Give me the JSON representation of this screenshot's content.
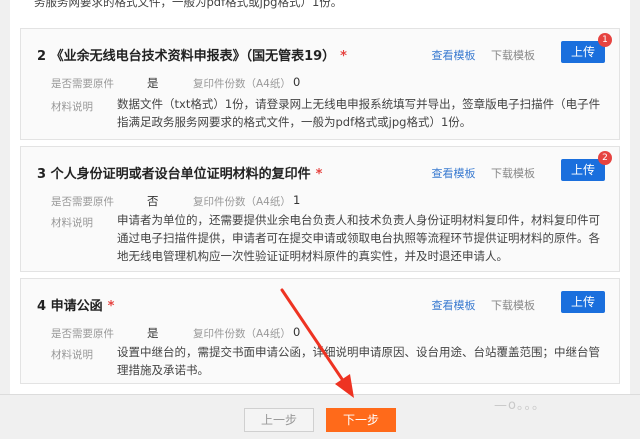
{
  "top_fragment": "务服务网要求的格式文件，一般为pdf格式或jpg格式）1份。",
  "labels": {
    "original_required": "是否需要原件",
    "copies": "复印件份数（A4纸）",
    "description": "材料说明",
    "view_template": "查看模板",
    "download_template": "下载模板",
    "upload": "上传"
  },
  "items": [
    {
      "title": "2 《业余无线电台技术资料申报表》（国无管表19）",
      "original_required": "是",
      "copies": "0",
      "description": "数据文件（txt格式）1份，请登录网上无线电申报系统填写并导出，签章版电子扫描件（电子件指满足政务服务网要求的格式文件，一般为pdf格式或jpg格式）1份。",
      "badge": "1"
    },
    {
      "title": "3 个人身份证明或者设台单位证明材料的复印件",
      "original_required": "否",
      "copies": "1",
      "description": "申请者为单位的，还需要提供业余电台负责人和技术负责人身份证明材料复印件，材料复印件可通过电子扫描件提供，申请者可在提交申请或领取电台执照等流程环节提供证明材料的原件。各地无线电管理机构应一次性验证证明材料原件的真实性，并及时退还申请人。",
      "badge": "2"
    },
    {
      "title": "4 申请公函",
      "original_required": "是",
      "copies": "0",
      "description": "设置中继台的，需提交书面申请公函，详细说明申请原因、设台用途、台站覆盖范围；中继台管理措施及承诺书。",
      "badge": ""
    }
  ],
  "required_mark": "*",
  "footer": {
    "prev": "上一步",
    "next": "下一步"
  },
  "watermark": "—o。。。",
  "colors": {
    "primary": "#1a6fdd",
    "accent": "#ff6a1a",
    "required": "#e64340",
    "arrow": "#ee3322"
  }
}
